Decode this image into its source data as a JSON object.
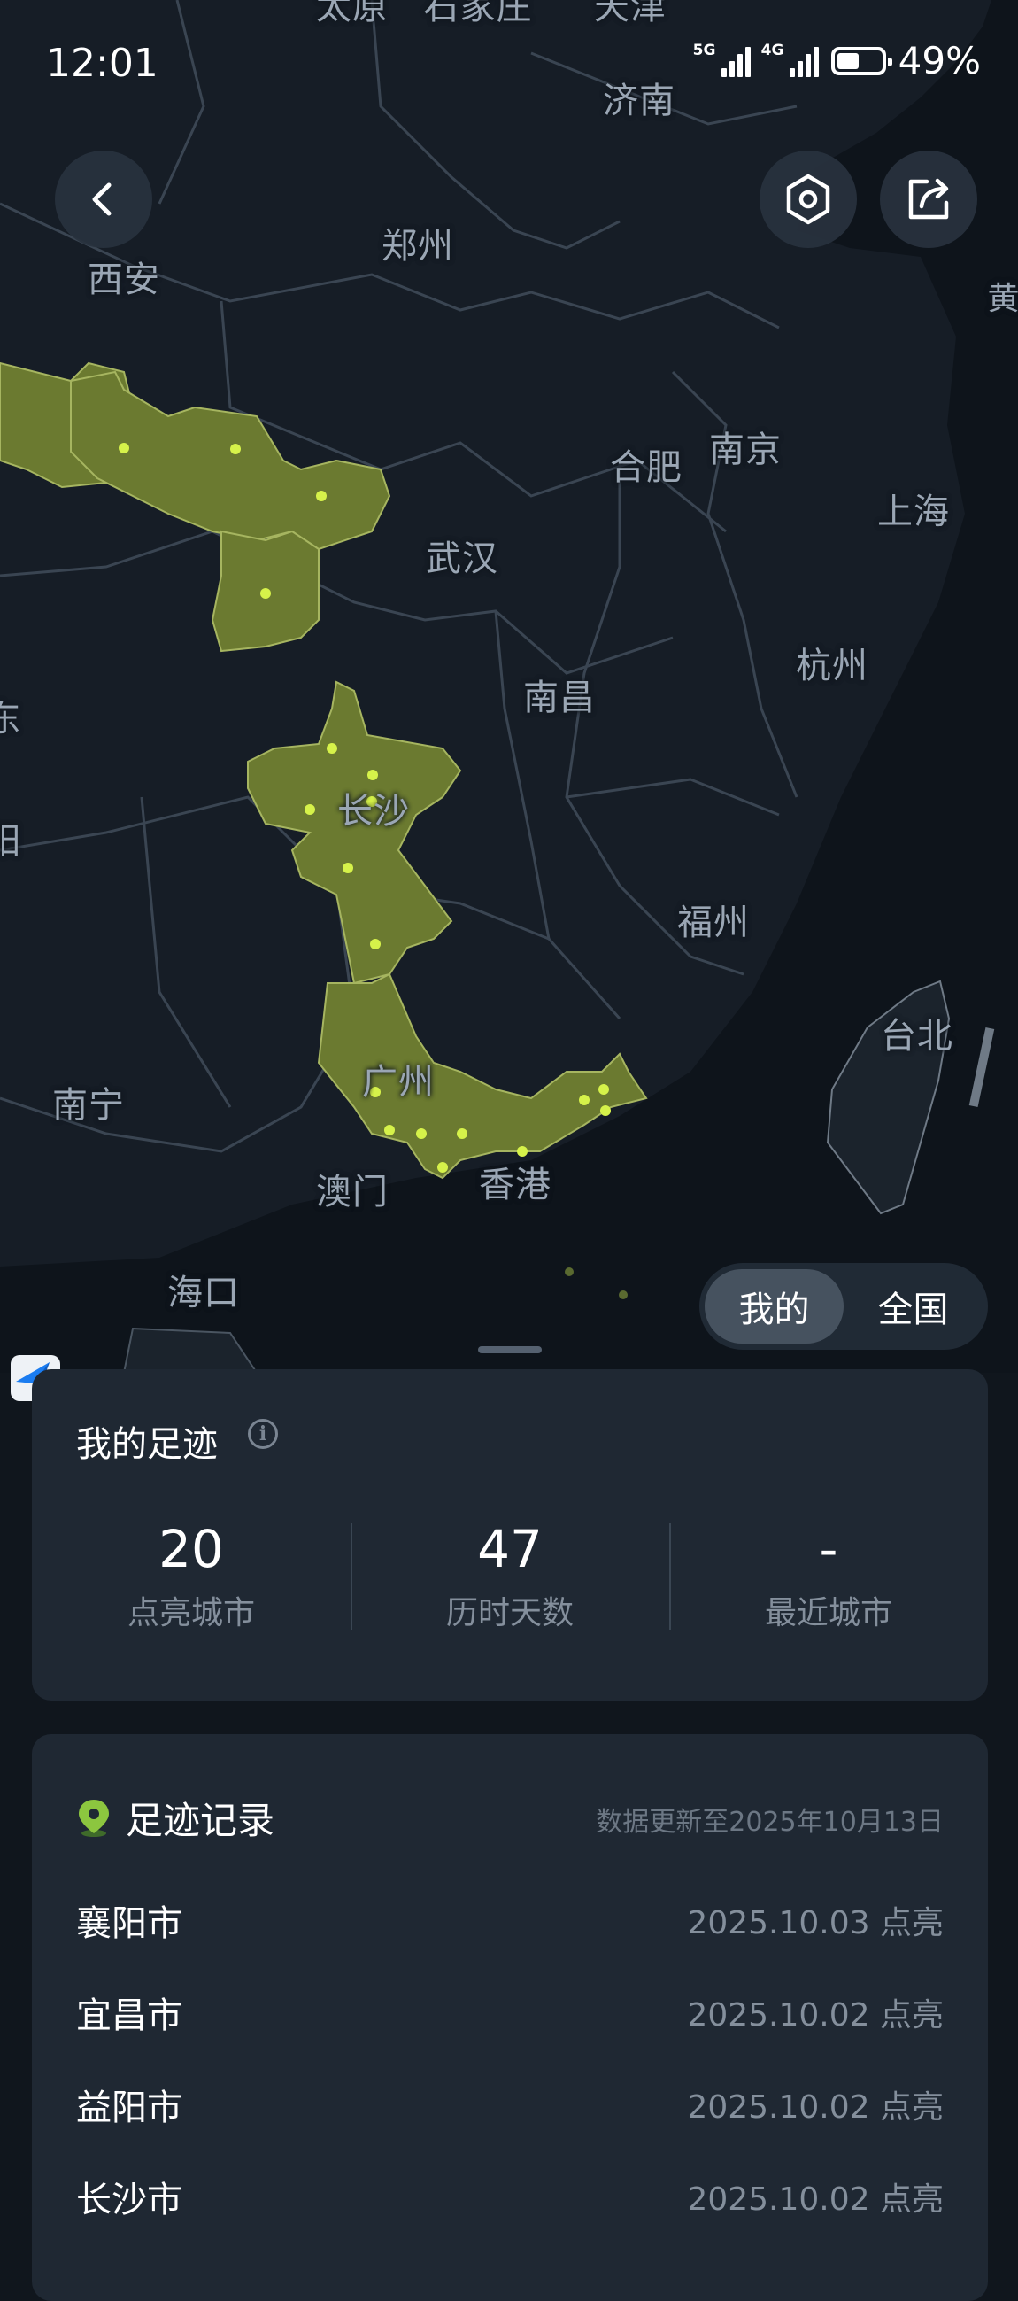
{
  "status_bar": {
    "time": "12:01",
    "network_1": "5G",
    "network_2": "4G",
    "battery_percent": 49,
    "battery_text": "49%"
  },
  "map": {
    "cities": [
      {
        "name": "太原",
        "id": "taiyuan"
      },
      {
        "name": "石家庄",
        "id": "shijiazhuang"
      },
      {
        "name": "天津",
        "id": "tianjin"
      },
      {
        "name": "济南",
        "id": "jinan"
      },
      {
        "name": "郑州",
        "id": "zhengzhou"
      },
      {
        "name": "西安",
        "id": "xian"
      },
      {
        "name": "黄",
        "id": "huang"
      },
      {
        "name": "南京",
        "id": "nanjing"
      },
      {
        "name": "合肥",
        "id": "hefei"
      },
      {
        "name": "上海",
        "id": "shanghai"
      },
      {
        "name": "武汉",
        "id": "wuhan"
      },
      {
        "name": "杭州",
        "id": "hangzhou"
      },
      {
        "name": "南昌",
        "id": "nanchang"
      },
      {
        "name": "长沙",
        "id": "changsha"
      },
      {
        "name": "福州",
        "id": "fuzhou"
      },
      {
        "name": "台北",
        "id": "taipei"
      },
      {
        "name": "广州",
        "id": "guangzhou"
      },
      {
        "name": "南宁",
        "id": "nanning"
      },
      {
        "name": "澳门",
        "id": "macau"
      },
      {
        "name": "香港",
        "id": "hongkong"
      },
      {
        "name": "海口",
        "id": "haikou"
      },
      {
        "name": "东",
        "id": "edge-dong"
      },
      {
        "name": "阳",
        "id": "edge-yang"
      }
    ],
    "colors": {
      "background": "#161d26",
      "lit_region": "#6b7a30",
      "lit_border": "#a6b560",
      "dot": "#d6f24a",
      "label": "#9aa6b4"
    },
    "toggle": {
      "mine_label": "我的",
      "all_label": "全国",
      "selected": "我的"
    }
  },
  "icons": {
    "back": "chevron-left-icon",
    "settings": "hexagon-settings-icon",
    "share": "share-icon",
    "info": "info-icon",
    "footprint": "location-pin-icon",
    "app": "app-logo-icon"
  },
  "footprint_summary": {
    "title": "我的足迹",
    "stats": [
      {
        "value": "20",
        "label": "点亮城市"
      },
      {
        "value": "47",
        "label": "历时天数"
      },
      {
        "value": "-",
        "label": "最近城市"
      }
    ]
  },
  "footprint_records": {
    "title": "足迹记录",
    "updated": "数据更新至2025年10月13日",
    "items": [
      {
        "city": "襄阳市",
        "date": "2025.10.03 点亮"
      },
      {
        "city": "宜昌市",
        "date": "2025.10.02 点亮"
      },
      {
        "city": "益阳市",
        "date": "2025.10.02 点亮"
      },
      {
        "city": "长沙市",
        "date": "2025.10.02 点亮"
      }
    ]
  }
}
